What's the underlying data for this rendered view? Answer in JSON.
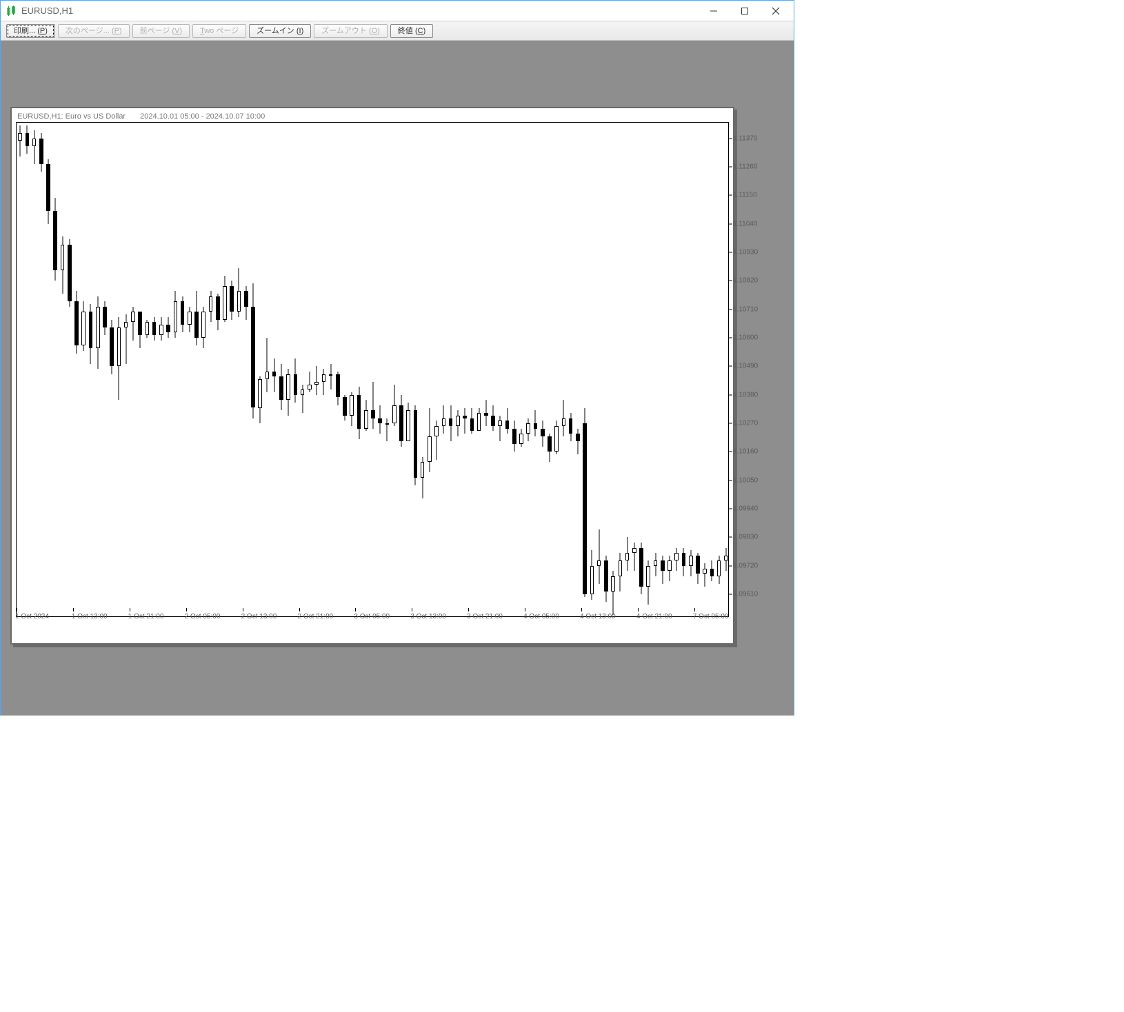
{
  "window": {
    "title": "EURUSD,H1"
  },
  "toolbar": {
    "print": {
      "pre": "印刷... (",
      "u": "P",
      "post": ")",
      "disabled": false,
      "focused": true
    },
    "next": {
      "pre": "次のページ... (",
      "u": "P",
      "post": ")",
      "disabled": true
    },
    "prev": {
      "pre": "前ページ (",
      "u": "V",
      "post": ")",
      "disabled": true
    },
    "two": {
      "pre": "",
      "u": "T",
      "post": "wo ページ",
      "disabled": true
    },
    "zoom_in": {
      "pre": "ズームイン (",
      "u": "I",
      "post": ")",
      "disabled": false
    },
    "zoom_out": {
      "pre": "ズームアウト (",
      "u": "O",
      "post": ")",
      "disabled": true
    },
    "close": {
      "pre": "終値 (",
      "u": "C",
      "post": ")",
      "disabled": false
    }
  },
  "chart": {
    "header": "EURUSD,H1:  Euro vs US Dollar",
    "date_range": "2024.10.01 05:00 - 2024.10.07 10:00"
  },
  "chart_data": {
    "type": "candlestick",
    "symbol": "EURUSD",
    "timeframe": "H1",
    "title": "EURUSD,H1:  Euro vs US Dollar",
    "subtitle": "2024.10.01 05:00 - 2024.10.07 10:00",
    "ylabel": "",
    "xlabel": "",
    "ylim": [
      1.0952,
      1.1143
    ],
    "y_ticks": [
      1.1137,
      1.1126,
      1.1115,
      1.1104,
      1.1093,
      1.1082,
      1.1071,
      1.106,
      1.1049,
      1.1038,
      1.1027,
      1.1016,
      1.1005,
      1.0994,
      1.0983,
      1.0972,
      1.0961
    ],
    "x_ticks": [
      {
        "idx": 0,
        "label": "1 Oct 2024"
      },
      {
        "idx": 8,
        "label": "1 Oct 13:00"
      },
      {
        "idx": 16,
        "label": "1 Oct 21:00"
      },
      {
        "idx": 24,
        "label": "2 Oct 05:00"
      },
      {
        "idx": 32,
        "label": "2 Oct 13:00"
      },
      {
        "idx": 40,
        "label": "2 Oct 21:00"
      },
      {
        "idx": 48,
        "label": "3 Oct 05:00"
      },
      {
        "idx": 56,
        "label": "3 Oct 13:00"
      },
      {
        "idx": 64,
        "label": "3 Oct 21:00"
      },
      {
        "idx": 72,
        "label": "4 Oct 05:00"
      },
      {
        "idx": 80,
        "label": "4 Oct 13:00"
      },
      {
        "idx": 88,
        "label": "4 Oct 21:00"
      },
      {
        "idx": 96,
        "label": "7 Oct 05:00"
      }
    ],
    "ohlc": [
      {
        "o": 1.1136,
        "h": 1.1142,
        "l": 1.113,
        "c": 1.1139
      },
      {
        "o": 1.1139,
        "h": 1.1142,
        "l": 1.1131,
        "c": 1.1134
      },
      {
        "o": 1.1134,
        "h": 1.114,
        "l": 1.1127,
        "c": 1.1137
      },
      {
        "o": 1.1137,
        "h": 1.1139,
        "l": 1.1124,
        "c": 1.1127
      },
      {
        "o": 1.1127,
        "h": 1.1129,
        "l": 1.1104,
        "c": 1.1109
      },
      {
        "o": 1.1109,
        "h": 1.1114,
        "l": 1.1082,
        "c": 1.1086
      },
      {
        "o": 1.1086,
        "h": 1.1099,
        "l": 1.1077,
        "c": 1.1096
      },
      {
        "o": 1.1096,
        "h": 1.1098,
        "l": 1.1072,
        "c": 1.1074
      },
      {
        "o": 1.1074,
        "h": 1.1078,
        "l": 1.1054,
        "c": 1.1057
      },
      {
        "o": 1.1057,
        "h": 1.1074,
        "l": 1.1055,
        "c": 1.107
      },
      {
        "o": 1.107,
        "h": 1.1073,
        "l": 1.105,
        "c": 1.1056
      },
      {
        "o": 1.1056,
        "h": 1.1076,
        "l": 1.1048,
        "c": 1.1072
      },
      {
        "o": 1.1072,
        "h": 1.1074,
        "l": 1.1061,
        "c": 1.1064
      },
      {
        "o": 1.1064,
        "h": 1.1067,
        "l": 1.1046,
        "c": 1.1049
      },
      {
        "o": 1.1049,
        "h": 1.1068,
        "l": 1.1036,
        "c": 1.1064
      },
      {
        "o": 1.1064,
        "h": 1.1069,
        "l": 1.105,
        "c": 1.1066
      },
      {
        "o": 1.1066,
        "h": 1.1072,
        "l": 1.1059,
        "c": 1.107
      },
      {
        "o": 1.107,
        "h": 1.107,
        "l": 1.1056,
        "c": 1.1061
      },
      {
        "o": 1.1061,
        "h": 1.1067,
        "l": 1.106,
        "c": 1.1066
      },
      {
        "o": 1.1066,
        "h": 1.1068,
        "l": 1.1059,
        "c": 1.1061
      },
      {
        "o": 1.1061,
        "h": 1.1068,
        "l": 1.1059,
        "c": 1.1065
      },
      {
        "o": 1.1065,
        "h": 1.1068,
        "l": 1.106,
        "c": 1.1062
      },
      {
        "o": 1.1062,
        "h": 1.1078,
        "l": 1.106,
        "c": 1.1074
      },
      {
        "o": 1.1074,
        "h": 1.1076,
        "l": 1.1062,
        "c": 1.1065
      },
      {
        "o": 1.1065,
        "h": 1.1072,
        "l": 1.1062,
        "c": 1.107
      },
      {
        "o": 1.107,
        "h": 1.1078,
        "l": 1.1057,
        "c": 1.106
      },
      {
        "o": 1.106,
        "h": 1.1072,
        "l": 1.1056,
        "c": 1.107
      },
      {
        "o": 1.107,
        "h": 1.1078,
        "l": 1.1066,
        "c": 1.1076
      },
      {
        "o": 1.1076,
        "h": 1.1077,
        "l": 1.1063,
        "c": 1.1067
      },
      {
        "o": 1.1067,
        "h": 1.1084,
        "l": 1.1066,
        "c": 1.108
      },
      {
        "o": 1.108,
        "h": 1.1082,
        "l": 1.1067,
        "c": 1.107
      },
      {
        "o": 1.107,
        "h": 1.1087,
        "l": 1.1068,
        "c": 1.1078
      },
      {
        "o": 1.1078,
        "h": 1.108,
        "l": 1.1067,
        "c": 1.1072
      },
      {
        "o": 1.1072,
        "h": 1.1081,
        "l": 1.1029,
        "c": 1.1033
      },
      {
        "o": 1.1033,
        "h": 1.1045,
        "l": 1.1027,
        "c": 1.1044
      },
      {
        "o": 1.1044,
        "h": 1.106,
        "l": 1.1039,
        "c": 1.1047
      },
      {
        "o": 1.1047,
        "h": 1.1052,
        "l": 1.1039,
        "c": 1.1045
      },
      {
        "o": 1.1045,
        "h": 1.105,
        "l": 1.1032,
        "c": 1.1036
      },
      {
        "o": 1.1036,
        "h": 1.1048,
        "l": 1.103,
        "c": 1.1046
      },
      {
        "o": 1.1046,
        "h": 1.1052,
        "l": 1.1035,
        "c": 1.1038
      },
      {
        "o": 1.1038,
        "h": 1.1042,
        "l": 1.1031,
        "c": 1.104
      },
      {
        "o": 1.104,
        "h": 1.1047,
        "l": 1.1039,
        "c": 1.1042
      },
      {
        "o": 1.1042,
        "h": 1.1049,
        "l": 1.1038,
        "c": 1.1043
      },
      {
        "o": 1.1043,
        "h": 1.1048,
        "l": 1.1038,
        "c": 1.1046
      },
      {
        "o": 1.1046,
        "h": 1.105,
        "l": 1.104,
        "c": 1.1046
      },
      {
        "o": 1.1046,
        "h": 1.1047,
        "l": 1.1034,
        "c": 1.1037
      },
      {
        "o": 1.1037,
        "h": 1.1038,
        "l": 1.1028,
        "c": 1.103
      },
      {
        "o": 1.103,
        "h": 1.1039,
        "l": 1.1026,
        "c": 1.1038
      },
      {
        "o": 1.1038,
        "h": 1.1041,
        "l": 1.1021,
        "c": 1.1025
      },
      {
        "o": 1.1025,
        "h": 1.1036,
        "l": 1.1024,
        "c": 1.1032
      },
      {
        "o": 1.1032,
        "h": 1.1043,
        "l": 1.1025,
        "c": 1.1029
      },
      {
        "o": 1.1029,
        "h": 1.1034,
        "l": 1.1023,
        "c": 1.1027
      },
      {
        "o": 1.1027,
        "h": 1.1029,
        "l": 1.102,
        "c": 1.1027
      },
      {
        "o": 1.1027,
        "h": 1.1042,
        "l": 1.1026,
        "c": 1.1034
      },
      {
        "o": 1.1034,
        "h": 1.1038,
        "l": 1.1018,
        "c": 1.102
      },
      {
        "o": 1.102,
        "h": 1.1035,
        "l": 1.102,
        "c": 1.1032
      },
      {
        "o": 1.1032,
        "h": 1.1034,
        "l": 1.1003,
        "c": 1.1006
      },
      {
        "o": 1.1006,
        "h": 1.1014,
        "l": 1.0998,
        "c": 1.1012
      },
      {
        "o": 1.1012,
        "h": 1.1033,
        "l": 1.1008,
        "c": 1.1022
      },
      {
        "o": 1.1022,
        "h": 1.1028,
        "l": 1.1013,
        "c": 1.1026
      },
      {
        "o": 1.1026,
        "h": 1.1034,
        "l": 1.1023,
        "c": 1.1029
      },
      {
        "o": 1.1029,
        "h": 1.1034,
        "l": 1.102,
        "c": 1.1026
      },
      {
        "o": 1.1026,
        "h": 1.1032,
        "l": 1.1022,
        "c": 1.103
      },
      {
        "o": 1.103,
        "h": 1.1033,
        "l": 1.1023,
        "c": 1.1029
      },
      {
        "o": 1.1029,
        "h": 1.1033,
        "l": 1.1023,
        "c": 1.1024
      },
      {
        "o": 1.1024,
        "h": 1.1033,
        "l": 1.1024,
        "c": 1.1031
      },
      {
        "o": 1.1031,
        "h": 1.1036,
        "l": 1.1026,
        "c": 1.103
      },
      {
        "o": 1.103,
        "h": 1.1034,
        "l": 1.1024,
        "c": 1.1026
      },
      {
        "o": 1.1026,
        "h": 1.103,
        "l": 1.102,
        "c": 1.1028
      },
      {
        "o": 1.1028,
        "h": 1.1033,
        "l": 1.1023,
        "c": 1.1025
      },
      {
        "o": 1.1025,
        "h": 1.1028,
        "l": 1.1016,
        "c": 1.1019
      },
      {
        "o": 1.1019,
        "h": 1.1025,
        "l": 1.1018,
        "c": 1.1023
      },
      {
        "o": 1.1023,
        "h": 1.1029,
        "l": 1.102,
        "c": 1.1027
      },
      {
        "o": 1.1027,
        "h": 1.1032,
        "l": 1.1022,
        "c": 1.1025
      },
      {
        "o": 1.1025,
        "h": 1.1028,
        "l": 1.1018,
        "c": 1.1022
      },
      {
        "o": 1.1022,
        "h": 1.1023,
        "l": 1.1012,
        "c": 1.1016
      },
      {
        "o": 1.1016,
        "h": 1.1028,
        "l": 1.1015,
        "c": 1.1026
      },
      {
        "o": 1.1026,
        "h": 1.1036,
        "l": 1.1022,
        "c": 1.1029
      },
      {
        "o": 1.1029,
        "h": 1.1031,
        "l": 1.102,
        "c": 1.1023
      },
      {
        "o": 1.1023,
        "h": 1.1025,
        "l": 1.1015,
        "c": 1.102
      },
      {
        "o": 1.1027,
        "h": 1.1033,
        "l": 1.096,
        "c": 1.0961
      },
      {
        "o": 1.0961,
        "h": 1.0978,
        "l": 1.0959,
        "c": 1.0972
      },
      {
        "o": 1.0972,
        "h": 1.0986,
        "l": 1.0965,
        "c": 1.0974
      },
      {
        "o": 1.0974,
        "h": 1.0976,
        "l": 1.0958,
        "c": 1.0962
      },
      {
        "o": 1.0962,
        "h": 1.097,
        "l": 1.0953,
        "c": 1.0968
      },
      {
        "o": 1.0968,
        "h": 1.0977,
        "l": 1.0962,
        "c": 1.0974
      },
      {
        "o": 1.0974,
        "h": 1.0983,
        "l": 1.097,
        "c": 1.0977
      },
      {
        "o": 1.0977,
        "h": 1.0981,
        "l": 1.097,
        "c": 1.0979
      },
      {
        "o": 1.0979,
        "h": 1.0981,
        "l": 1.0961,
        "c": 1.0964
      },
      {
        "o": 1.0964,
        "h": 1.0974,
        "l": 1.0957,
        "c": 1.0972
      },
      {
        "o": 1.0972,
        "h": 1.0977,
        "l": 1.0968,
        "c": 1.0974
      },
      {
        "o": 1.0974,
        "h": 1.0976,
        "l": 1.0965,
        "c": 1.097
      },
      {
        "o": 1.097,
        "h": 1.0976,
        "l": 1.0966,
        "c": 1.0974
      },
      {
        "o": 1.0974,
        "h": 1.0979,
        "l": 1.097,
        "c": 1.0977
      },
      {
        "o": 1.0977,
        "h": 1.0979,
        "l": 1.0968,
        "c": 1.0972
      },
      {
        "o": 1.0972,
        "h": 1.0978,
        "l": 1.0968,
        "c": 1.0976
      },
      {
        "o": 1.0976,
        "h": 1.0977,
        "l": 1.0965,
        "c": 1.0969
      },
      {
        "o": 1.0969,
        "h": 1.0973,
        "l": 1.0964,
        "c": 1.0971
      },
      {
        "o": 1.0971,
        "h": 1.0974,
        "l": 1.0966,
        "c": 1.0968
      },
      {
        "o": 1.0968,
        "h": 1.0976,
        "l": 1.0965,
        "c": 1.0974
      },
      {
        "o": 1.0974,
        "h": 1.0979,
        "l": 1.097,
        "c": 1.0976
      }
    ]
  }
}
